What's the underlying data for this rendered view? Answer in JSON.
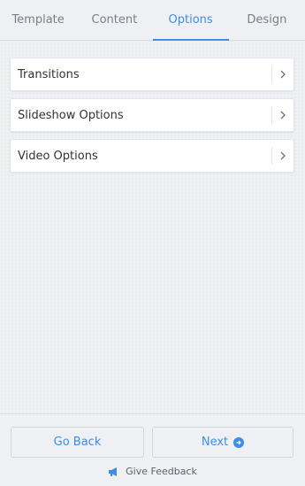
{
  "tabs": [
    {
      "label": "Template",
      "active": false
    },
    {
      "label": "Content",
      "active": false
    },
    {
      "label": "Options",
      "active": true
    },
    {
      "label": "Design",
      "active": false
    }
  ],
  "options": [
    {
      "label": "Transitions",
      "icon": "chevron-right-icon"
    },
    {
      "label": "Slideshow Options",
      "icon": "chevron-right-icon"
    },
    {
      "label": "Video Options",
      "icon": "chevron-right-icon"
    }
  ],
  "footer": {
    "back_label": "Go Back",
    "next_label": "Next",
    "next_icon": "arrow-right-circle-icon",
    "feedback_label": "Give Feedback",
    "feedback_icon": "megaphone-icon"
  },
  "colors": {
    "accent": "#3f8de6",
    "background": "#eef0f3",
    "card": "#ffffff"
  }
}
